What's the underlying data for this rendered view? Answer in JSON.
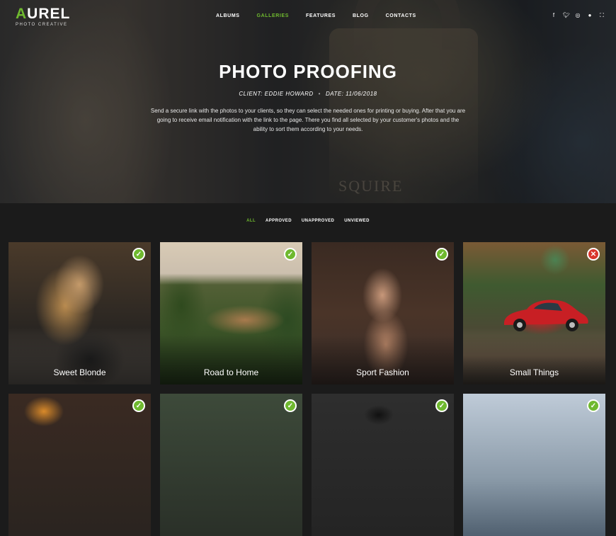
{
  "brand": {
    "name_accent": "A",
    "name_rest": "UREL",
    "tagline": "PHOTO CREATIVE"
  },
  "nav": [
    {
      "label": "ALBUMS",
      "active": false
    },
    {
      "label": "GALLERIES",
      "active": true
    },
    {
      "label": "FEATURES",
      "active": false
    },
    {
      "label": "BLOG",
      "active": false
    },
    {
      "label": "CONTACTS",
      "active": false
    }
  ],
  "socials": [
    "facebook-icon",
    "twitter-icon",
    "instagram-icon",
    "dribbble-icon",
    "fullscreen-icon"
  ],
  "hero": {
    "title": "PHOTO PROOFING",
    "client": "CLIENT: EDDIE HOWARD",
    "date": "DATE: 11/06/2018",
    "description": "Send a secure link with the photos to your clients, so they can select the needed ones for printing or buying. After that you are going to receive email notification with the link to the page. There you find all selected by your customer's photos and the ability to sort them according to your needs.",
    "lock_text": "SQUIRE"
  },
  "filters": [
    {
      "label": "ALL",
      "active": true
    },
    {
      "label": "APPROVED",
      "active": false
    },
    {
      "label": "UNAPPROVED",
      "active": false
    },
    {
      "label": "UNVIEWED",
      "active": false
    }
  ],
  "gallery": [
    {
      "caption": "Sweet Blonde",
      "status": "approved"
    },
    {
      "caption": "Road to Home",
      "status": "approved"
    },
    {
      "caption": "Sport Fashion",
      "status": "approved"
    },
    {
      "caption": "Small Things",
      "status": "unapproved"
    },
    {
      "caption": "",
      "status": "approved"
    },
    {
      "caption": "",
      "status": "approved"
    },
    {
      "caption": "",
      "status": "approved"
    },
    {
      "caption": "",
      "status": "approved"
    }
  ],
  "colors": {
    "accent": "#6fb92f",
    "reject": "#d9352c",
    "background": "#1b1b1b"
  }
}
